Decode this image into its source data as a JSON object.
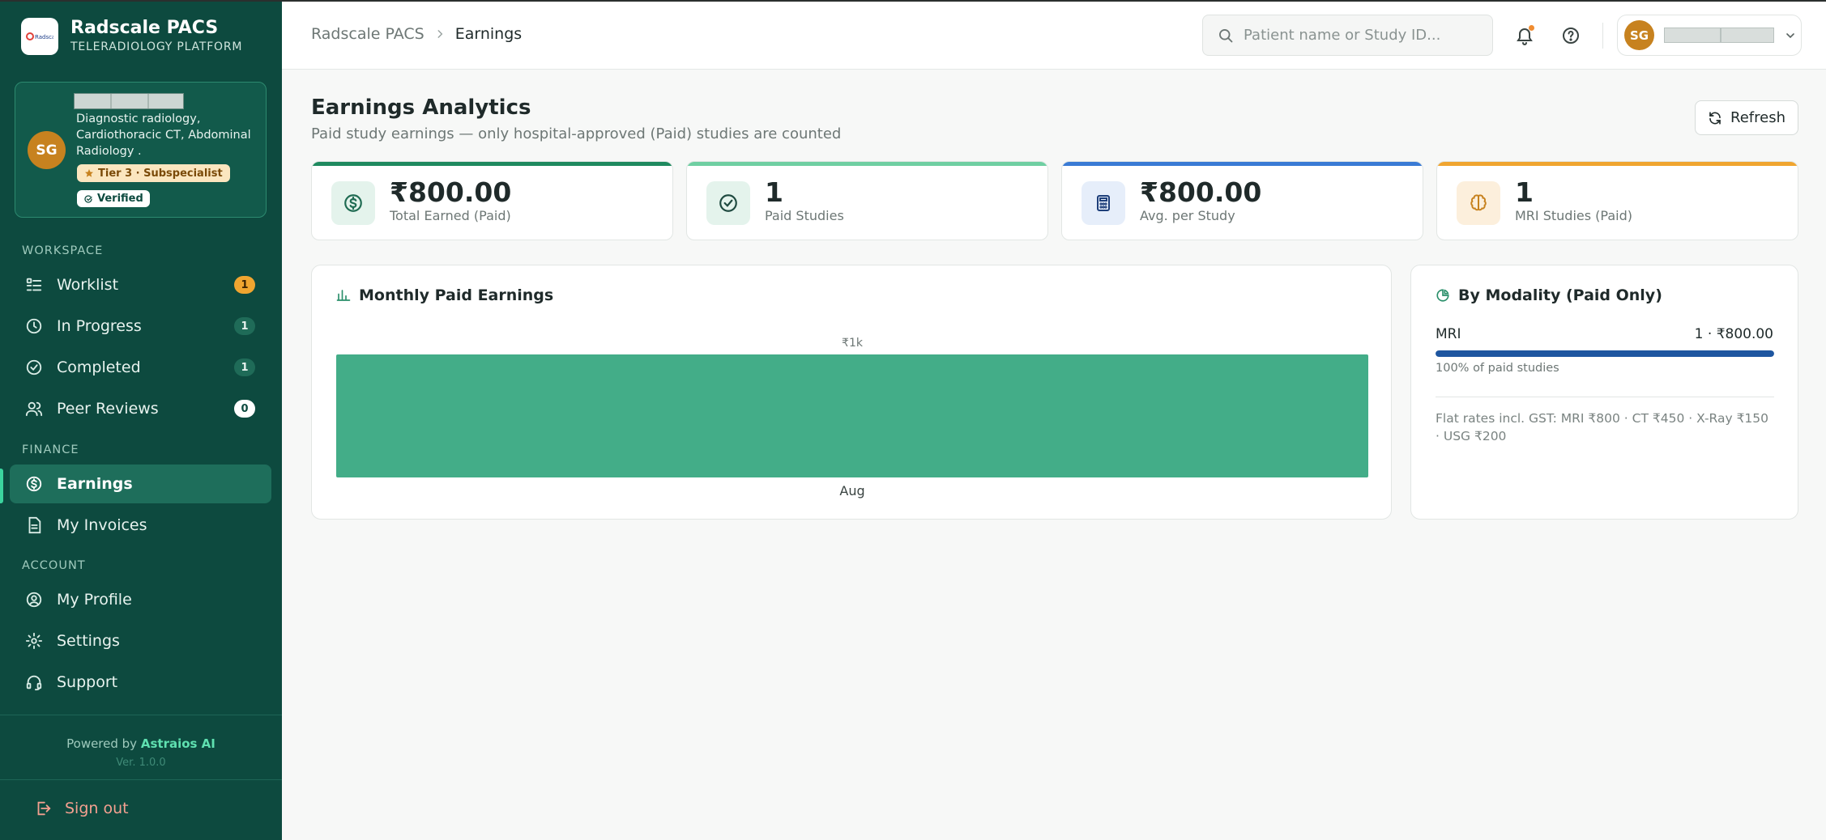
{
  "app": {
    "name": "Radscale PACS",
    "subtitle": "TELERADIOLOGY PLATFORM",
    "logo_text": "Radscale"
  },
  "profile": {
    "initials": "SG",
    "specialty": "Diagnostic radiology, Cardiothoracic CT, Abdominal Radiology .",
    "tier": "Tier 3 · Subspecialist",
    "verified": "Verified"
  },
  "nav": {
    "workspace_label": "WORKSPACE",
    "worklist": {
      "label": "Worklist",
      "count": "1"
    },
    "in_progress": {
      "label": "In Progress",
      "count": "1"
    },
    "completed": {
      "label": "Completed",
      "count": "1"
    },
    "peer_reviews": {
      "label": "Peer Reviews",
      "count": "0"
    },
    "finance_label": "FINANCE",
    "earnings": {
      "label": "Earnings"
    },
    "invoices": {
      "label": "My Invoices"
    },
    "account_label": "ACCOUNT",
    "profile": {
      "label": "My Profile"
    },
    "settings": {
      "label": "Settings"
    },
    "support": {
      "label": "Support"
    }
  },
  "footer": {
    "powered_prefix": "Powered by",
    "powered_brand": "Astraios AI",
    "version": "Ver. 1.0.0",
    "signout": "Sign out"
  },
  "header": {
    "breadcrumb_root": "Radscale PACS",
    "breadcrumb_current": "Earnings",
    "search_placeholder": "Patient name or Study ID...",
    "user_initials": "SG"
  },
  "page": {
    "title": "Earnings Analytics",
    "subtitle": "Paid study earnings — only hospital-approved (Paid) studies are counted",
    "refresh_label": "Refresh"
  },
  "stats": [
    {
      "value": "₹800.00",
      "label": "Total Earned (Paid)",
      "accent": "#1f8a5f",
      "icon": "dollar-circle-icon"
    },
    {
      "value": "1",
      "label": "Paid Studies",
      "accent": "#6fcfa2",
      "icon": "check-circle-icon"
    },
    {
      "value": "₹800.00",
      "label": "Avg. per Study",
      "accent": "#3a7bd5",
      "icon": "calculator-icon"
    },
    {
      "value": "1",
      "label": "MRI Studies (Paid)",
      "accent": "#f0a530",
      "icon": "brain-icon"
    }
  ],
  "monthly": {
    "title": "Monthly Paid Earnings"
  },
  "chart_data": {
    "type": "bar",
    "categories": [
      "Aug"
    ],
    "values": [
      800
    ],
    "value_labels": [
      "₹1k"
    ],
    "color": "#43ad88",
    "grid": false
  },
  "modality": {
    "title": "By Modality (Paid Only)",
    "name": "MRI",
    "value": "1 · ₹800.00",
    "percent": 100,
    "percent_label": "100% of paid studies",
    "bar_color": "#1e56a0",
    "rates": "Flat rates incl. GST: MRI ₹800 · CT ₹450 · X-Ray ₹150 · USG ₹200"
  }
}
